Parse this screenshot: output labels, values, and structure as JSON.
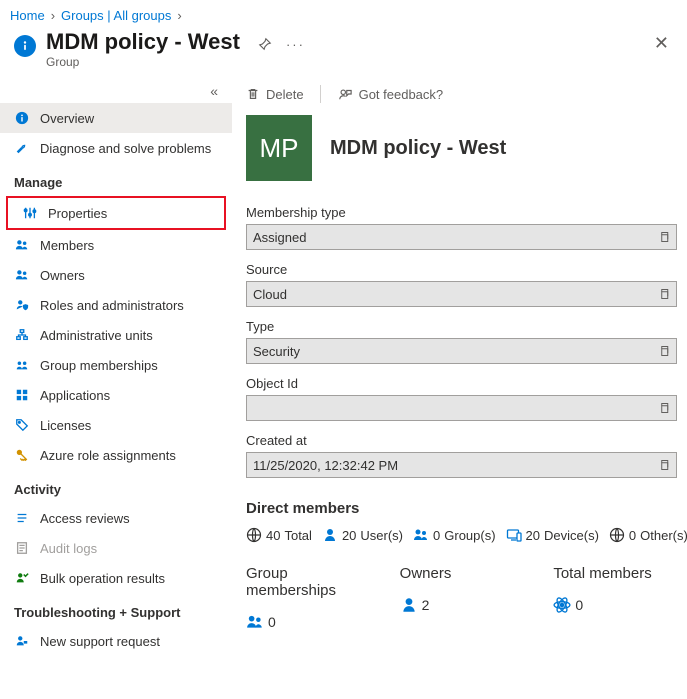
{
  "breadcrumb": [
    {
      "label": "Home"
    },
    {
      "label": "Groups | All groups"
    }
  ],
  "header": {
    "title": "MDM policy - West",
    "subtitle": "Group"
  },
  "sidebar": {
    "items": [
      {
        "label": "Overview",
        "icon": "info",
        "selected": true
      },
      {
        "label": "Diagnose and solve problems",
        "icon": "wrench"
      }
    ],
    "manage_label": "Manage",
    "manage_items": [
      {
        "label": "Properties",
        "icon": "sliders",
        "highlighted": true
      },
      {
        "label": "Members",
        "icon": "people"
      },
      {
        "label": "Owners",
        "icon": "people"
      },
      {
        "label": "Roles and administrators",
        "icon": "person-shield"
      },
      {
        "label": "Administrative units",
        "icon": "org"
      },
      {
        "label": "Group memberships",
        "icon": "group"
      },
      {
        "label": "Applications",
        "icon": "apps"
      },
      {
        "label": "Licenses",
        "icon": "tag"
      },
      {
        "label": "Azure role assignments",
        "icon": "key",
        "iconColor": "orange"
      }
    ],
    "activity_label": "Activity",
    "activity_items": [
      {
        "label": "Access reviews",
        "icon": "list"
      },
      {
        "label": "Audit logs",
        "icon": "logs",
        "disabled": true
      },
      {
        "label": "Bulk operation results",
        "icon": "bulk"
      }
    ],
    "support_label": "Troubleshooting + Support",
    "support_items": [
      {
        "label": "New support request",
        "icon": "support"
      }
    ]
  },
  "toolbar": {
    "delete_label": "Delete",
    "feedback_label": "Got feedback?"
  },
  "group": {
    "avatar_initials": "MP",
    "name": "MDM policy - West"
  },
  "fields": {
    "membership_type": {
      "label": "Membership type",
      "value": "Assigned"
    },
    "source": {
      "label": "Source",
      "value": "Cloud"
    },
    "type": {
      "label": "Type",
      "value": "Security"
    },
    "object_id": {
      "label": "Object Id",
      "value": ""
    },
    "created_at": {
      "label": "Created at",
      "value": "11/25/2020, 12:32:42 PM"
    }
  },
  "direct_members": {
    "title": "Direct members",
    "stats": {
      "total": {
        "count": 40,
        "label": "Total"
      },
      "users": {
        "count": 20,
        "label": "User(s)"
      },
      "groups": {
        "count": 0,
        "label": "Group(s)"
      },
      "devices": {
        "count": 20,
        "label": "Device(s)"
      },
      "others": {
        "count": 0,
        "label": "Other(s)"
      }
    }
  },
  "bottom": {
    "group_memberships": {
      "title": "Group memberships",
      "count": 0
    },
    "owners": {
      "title": "Owners",
      "count": 2
    },
    "total_members": {
      "title": "Total members",
      "count": 0
    }
  }
}
